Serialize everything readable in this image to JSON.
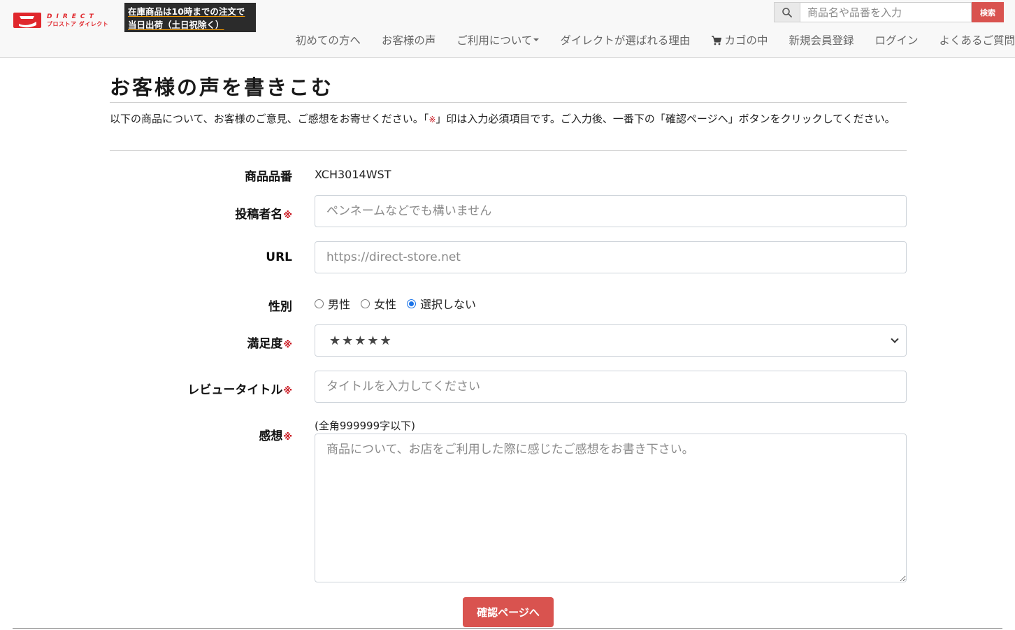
{
  "header": {
    "logo_en": "DIRECT",
    "logo_jp": "プロストア ダイレクト",
    "banner": {
      "line1": "在庫商品は10時までの注文で",
      "line2": "当日出荷（土日祝除く）"
    },
    "search": {
      "placeholder": "商品名や品番を入力",
      "button": "検索",
      "icon": "search-icon"
    },
    "nav": [
      {
        "label": "初めての方へ"
      },
      {
        "label": "お客様の声"
      },
      {
        "label": "ご利用について",
        "dropdown": true
      },
      {
        "label": "ダイレクトが選ばれる理由"
      },
      {
        "label": "カゴの中",
        "icon": "cart-icon"
      },
      {
        "label": "新規会員登録"
      },
      {
        "label": "ログイン"
      },
      {
        "label": "よくあるご質問"
      }
    ]
  },
  "page": {
    "title": "お客様の声を書きこむ",
    "intro_before": "以下の商品について、お客様のご意見、ご感想をお寄せください。「",
    "intro_mark": "※",
    "intro_after": "」印は入力必須項目です。ご入力後、一番下の「確認ページへ」ボタンをクリックしてください。"
  },
  "form": {
    "required_mark": "※",
    "product_code": {
      "label": "商品品番",
      "value": "XCH3014WST"
    },
    "author": {
      "label": "投稿者名",
      "placeholder": "ペンネームなどでも構いません",
      "required": true
    },
    "url": {
      "label": "URL",
      "placeholder": "https://direct-store.net"
    },
    "gender": {
      "label": "性別",
      "options": [
        {
          "label": "男性",
          "checked": false
        },
        {
          "label": "女性",
          "checked": false
        },
        {
          "label": "選択しない",
          "checked": true
        }
      ]
    },
    "rating": {
      "label": "満足度",
      "value": "★★★★★",
      "stars": 5,
      "required": true
    },
    "review_title": {
      "label": "レビュータイトル",
      "placeholder": "タイトルを入力してください",
      "required": true
    },
    "comment": {
      "label": "感想",
      "hint": "(全角999999字以下)",
      "placeholder": "商品について、お店をご利用した際に感じたご感想をお書き下さい。",
      "required": true
    },
    "submit": "確認ページへ"
  },
  "colors": {
    "accent": "#d9534f",
    "required": "#c9151e",
    "logo": "#e0282d",
    "radio_selected": "#1a73e8"
  }
}
